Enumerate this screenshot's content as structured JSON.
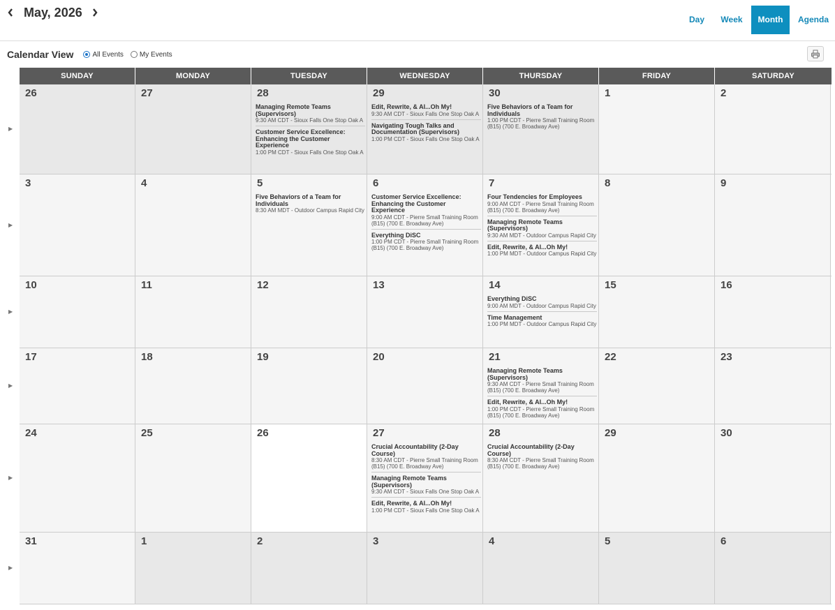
{
  "header": {
    "month_title": "May, 2026",
    "views": [
      {
        "label": "Day",
        "active": false
      },
      {
        "label": "Week",
        "active": false
      },
      {
        "label": "Month",
        "active": true
      },
      {
        "label": "Agenda",
        "active": false
      }
    ],
    "calendar_view_label": "Calendar View",
    "filter_all": "All Events",
    "filter_mine": "My Events",
    "selected_filter": "All Events"
  },
  "weekdays": [
    "SUNDAY",
    "MONDAY",
    "TUESDAY",
    "WEDNESDAY",
    "THURSDAY",
    "FRIDAY",
    "SATURDAY"
  ],
  "colors": {
    "header_bg": "#5a5a5a",
    "accent": "#0e8fbf",
    "other_month_bg": "#e8e8e8",
    "cell_bg": "#f5f5f5",
    "today_bg": "#ffffff"
  },
  "weeks": [
    {
      "days": [
        {
          "num": "26",
          "other": true,
          "events": []
        },
        {
          "num": "27",
          "other": true,
          "events": []
        },
        {
          "num": "28",
          "other": true,
          "events": [
            {
              "title": "Managing Remote Teams (Supervisors)",
              "meta": "9:30 AM CDT - Sioux Falls One Stop Oak A"
            },
            {
              "title": "Customer Service Excellence: Enhancing the Customer Experience",
              "meta": "1:00 PM CDT - Sioux Falls One Stop Oak A"
            }
          ]
        },
        {
          "num": "29",
          "other": true,
          "events": [
            {
              "title": "Edit, Rewrite, & AI...Oh My!",
              "meta": "9:30 AM CDT - Sioux Falls One Stop Oak A"
            },
            {
              "title": "Navigating Tough Talks and Documentation (Supervisors)",
              "meta": "1:00 PM CDT - Sioux Falls One Stop Oak A"
            }
          ]
        },
        {
          "num": "30",
          "other": true,
          "events": [
            {
              "title": "Five Behaviors of a Team for Individuals",
              "meta": "1:00 PM CDT - Pierre Small Training Room (B15) (700 E. Broadway Ave)"
            }
          ]
        },
        {
          "num": "1",
          "other": false,
          "events": []
        },
        {
          "num": "2",
          "other": false,
          "events": []
        }
      ]
    },
    {
      "days": [
        {
          "num": "3",
          "other": false,
          "events": []
        },
        {
          "num": "4",
          "other": false,
          "events": []
        },
        {
          "num": "5",
          "other": false,
          "events": [
            {
              "title": "Five Behaviors of a Team for Individuals",
              "meta": "8:30 AM MDT - Outdoor Campus Rapid City"
            }
          ]
        },
        {
          "num": "6",
          "other": false,
          "events": [
            {
              "title": "Customer Service Excellence: Enhancing the Customer Experience",
              "meta": "9:00 AM CDT - Pierre Small Training Room (B15) (700 E. Broadway Ave)"
            },
            {
              "title": "Everything DiSC",
              "meta": "1:00 PM CDT - Pierre Small Training Room (B15) (700 E. Broadway Ave)"
            }
          ]
        },
        {
          "num": "7",
          "other": false,
          "events": [
            {
              "title": "Four Tendencies for Employees",
              "meta": "9:00 AM CDT - Pierre Small Training Room (B15) (700 E. Broadway Ave)"
            },
            {
              "title": "Managing Remote Teams (Supervisors)",
              "meta": "9:30 AM MDT - Outdoor Campus Rapid City"
            },
            {
              "title": "Edit, Rewrite, & AI...Oh My!",
              "meta": "1:00 PM MDT - Outdoor Campus Rapid City"
            }
          ]
        },
        {
          "num": "8",
          "other": false,
          "events": []
        },
        {
          "num": "9",
          "other": false,
          "events": []
        }
      ]
    },
    {
      "days": [
        {
          "num": "10",
          "other": false,
          "events": []
        },
        {
          "num": "11",
          "other": false,
          "events": []
        },
        {
          "num": "12",
          "other": false,
          "events": []
        },
        {
          "num": "13",
          "other": false,
          "events": []
        },
        {
          "num": "14",
          "other": false,
          "events": [
            {
              "title": "Everything DiSC",
              "meta": "9:00 AM MDT - Outdoor Campus Rapid City"
            },
            {
              "title": "Time Management",
              "meta": "1:00 PM MDT - Outdoor Campus Rapid City"
            }
          ]
        },
        {
          "num": "15",
          "other": false,
          "events": []
        },
        {
          "num": "16",
          "other": false,
          "events": []
        }
      ]
    },
    {
      "days": [
        {
          "num": "17",
          "other": false,
          "events": []
        },
        {
          "num": "18",
          "other": false,
          "events": []
        },
        {
          "num": "19",
          "other": false,
          "events": []
        },
        {
          "num": "20",
          "other": false,
          "events": []
        },
        {
          "num": "21",
          "other": false,
          "events": [
            {
              "title": "Managing Remote Teams (Supervisors)",
              "meta": "9:30 AM CDT - Pierre Small Training Room (B15) (700 E. Broadway Ave)"
            },
            {
              "title": "Edit, Rewrite, & AI...Oh My!",
              "meta": "1:00 PM CDT - Pierre Small Training Room (B15) (700 E. Broadway Ave)"
            }
          ]
        },
        {
          "num": "22",
          "other": false,
          "events": []
        },
        {
          "num": "23",
          "other": false,
          "events": []
        }
      ]
    },
    {
      "days": [
        {
          "num": "24",
          "other": false,
          "events": []
        },
        {
          "num": "25",
          "other": false,
          "events": []
        },
        {
          "num": "26",
          "other": false,
          "today": true,
          "events": []
        },
        {
          "num": "27",
          "other": false,
          "events": [
            {
              "title": "Crucial Accountability (2-Day Course)",
              "meta": "8:30 AM CDT - Pierre Small Training Room (B15) (700 E. Broadway Ave)"
            },
            {
              "title": "Managing Remote Teams (Supervisors)",
              "meta": "9:30 AM CDT - Sioux Falls One Stop Oak A"
            },
            {
              "title": "Edit, Rewrite, & AI...Oh My!",
              "meta": "1:00 PM CDT - Sioux Falls One Stop Oak A"
            }
          ]
        },
        {
          "num": "28",
          "other": false,
          "events": [
            {
              "title": "Crucial Accountability (2-Day Course)",
              "meta": "8:30 AM CDT - Pierre Small Training Room (B15) (700 E. Broadway Ave)"
            }
          ]
        },
        {
          "num": "29",
          "other": false,
          "events": []
        },
        {
          "num": "30",
          "other": false,
          "events": []
        }
      ]
    },
    {
      "days": [
        {
          "num": "31",
          "other": false,
          "events": []
        },
        {
          "num": "1",
          "other": true,
          "events": []
        },
        {
          "num": "2",
          "other": true,
          "events": []
        },
        {
          "num": "3",
          "other": true,
          "events": []
        },
        {
          "num": "4",
          "other": true,
          "events": []
        },
        {
          "num": "5",
          "other": true,
          "events": []
        },
        {
          "num": "6",
          "other": true,
          "events": []
        }
      ]
    }
  ]
}
